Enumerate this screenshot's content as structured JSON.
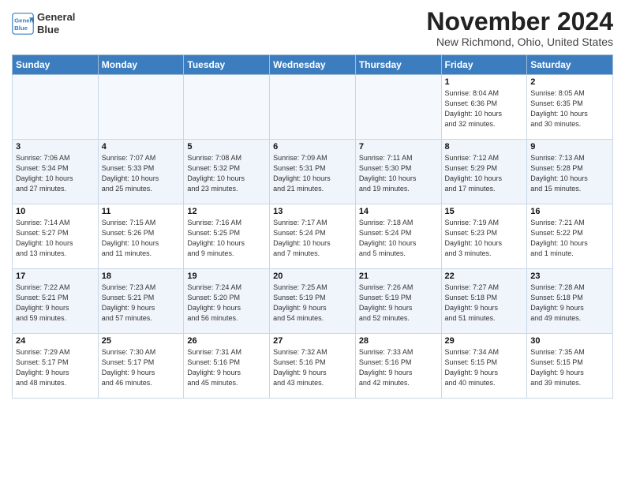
{
  "header": {
    "logo_line1": "General",
    "logo_line2": "Blue",
    "month": "November 2024",
    "location": "New Richmond, Ohio, United States"
  },
  "weekdays": [
    "Sunday",
    "Monday",
    "Tuesday",
    "Wednesday",
    "Thursday",
    "Friday",
    "Saturday"
  ],
  "weeks": [
    [
      {
        "day": "",
        "info": ""
      },
      {
        "day": "",
        "info": ""
      },
      {
        "day": "",
        "info": ""
      },
      {
        "day": "",
        "info": ""
      },
      {
        "day": "",
        "info": ""
      },
      {
        "day": "1",
        "info": "Sunrise: 8:04 AM\nSunset: 6:36 PM\nDaylight: 10 hours\nand 32 minutes."
      },
      {
        "day": "2",
        "info": "Sunrise: 8:05 AM\nSunset: 6:35 PM\nDaylight: 10 hours\nand 30 minutes."
      }
    ],
    [
      {
        "day": "3",
        "info": "Sunrise: 7:06 AM\nSunset: 5:34 PM\nDaylight: 10 hours\nand 27 minutes."
      },
      {
        "day": "4",
        "info": "Sunrise: 7:07 AM\nSunset: 5:33 PM\nDaylight: 10 hours\nand 25 minutes."
      },
      {
        "day": "5",
        "info": "Sunrise: 7:08 AM\nSunset: 5:32 PM\nDaylight: 10 hours\nand 23 minutes."
      },
      {
        "day": "6",
        "info": "Sunrise: 7:09 AM\nSunset: 5:31 PM\nDaylight: 10 hours\nand 21 minutes."
      },
      {
        "day": "7",
        "info": "Sunrise: 7:11 AM\nSunset: 5:30 PM\nDaylight: 10 hours\nand 19 minutes."
      },
      {
        "day": "8",
        "info": "Sunrise: 7:12 AM\nSunset: 5:29 PM\nDaylight: 10 hours\nand 17 minutes."
      },
      {
        "day": "9",
        "info": "Sunrise: 7:13 AM\nSunset: 5:28 PM\nDaylight: 10 hours\nand 15 minutes."
      }
    ],
    [
      {
        "day": "10",
        "info": "Sunrise: 7:14 AM\nSunset: 5:27 PM\nDaylight: 10 hours\nand 13 minutes."
      },
      {
        "day": "11",
        "info": "Sunrise: 7:15 AM\nSunset: 5:26 PM\nDaylight: 10 hours\nand 11 minutes."
      },
      {
        "day": "12",
        "info": "Sunrise: 7:16 AM\nSunset: 5:25 PM\nDaylight: 10 hours\nand 9 minutes."
      },
      {
        "day": "13",
        "info": "Sunrise: 7:17 AM\nSunset: 5:24 PM\nDaylight: 10 hours\nand 7 minutes."
      },
      {
        "day": "14",
        "info": "Sunrise: 7:18 AM\nSunset: 5:24 PM\nDaylight: 10 hours\nand 5 minutes."
      },
      {
        "day": "15",
        "info": "Sunrise: 7:19 AM\nSunset: 5:23 PM\nDaylight: 10 hours\nand 3 minutes."
      },
      {
        "day": "16",
        "info": "Sunrise: 7:21 AM\nSunset: 5:22 PM\nDaylight: 10 hours\nand 1 minute."
      }
    ],
    [
      {
        "day": "17",
        "info": "Sunrise: 7:22 AM\nSunset: 5:21 PM\nDaylight: 9 hours\nand 59 minutes."
      },
      {
        "day": "18",
        "info": "Sunrise: 7:23 AM\nSunset: 5:21 PM\nDaylight: 9 hours\nand 57 minutes."
      },
      {
        "day": "19",
        "info": "Sunrise: 7:24 AM\nSunset: 5:20 PM\nDaylight: 9 hours\nand 56 minutes."
      },
      {
        "day": "20",
        "info": "Sunrise: 7:25 AM\nSunset: 5:19 PM\nDaylight: 9 hours\nand 54 minutes."
      },
      {
        "day": "21",
        "info": "Sunrise: 7:26 AM\nSunset: 5:19 PM\nDaylight: 9 hours\nand 52 minutes."
      },
      {
        "day": "22",
        "info": "Sunrise: 7:27 AM\nSunset: 5:18 PM\nDaylight: 9 hours\nand 51 minutes."
      },
      {
        "day": "23",
        "info": "Sunrise: 7:28 AM\nSunset: 5:18 PM\nDaylight: 9 hours\nand 49 minutes."
      }
    ],
    [
      {
        "day": "24",
        "info": "Sunrise: 7:29 AM\nSunset: 5:17 PM\nDaylight: 9 hours\nand 48 minutes."
      },
      {
        "day": "25",
        "info": "Sunrise: 7:30 AM\nSunset: 5:17 PM\nDaylight: 9 hours\nand 46 minutes."
      },
      {
        "day": "26",
        "info": "Sunrise: 7:31 AM\nSunset: 5:16 PM\nDaylight: 9 hours\nand 45 minutes."
      },
      {
        "day": "27",
        "info": "Sunrise: 7:32 AM\nSunset: 5:16 PM\nDaylight: 9 hours\nand 43 minutes."
      },
      {
        "day": "28",
        "info": "Sunrise: 7:33 AM\nSunset: 5:16 PM\nDaylight: 9 hours\nand 42 minutes."
      },
      {
        "day": "29",
        "info": "Sunrise: 7:34 AM\nSunset: 5:15 PM\nDaylight: 9 hours\nand 40 minutes."
      },
      {
        "day": "30",
        "info": "Sunrise: 7:35 AM\nSunset: 5:15 PM\nDaylight: 9 hours\nand 39 minutes."
      }
    ]
  ]
}
